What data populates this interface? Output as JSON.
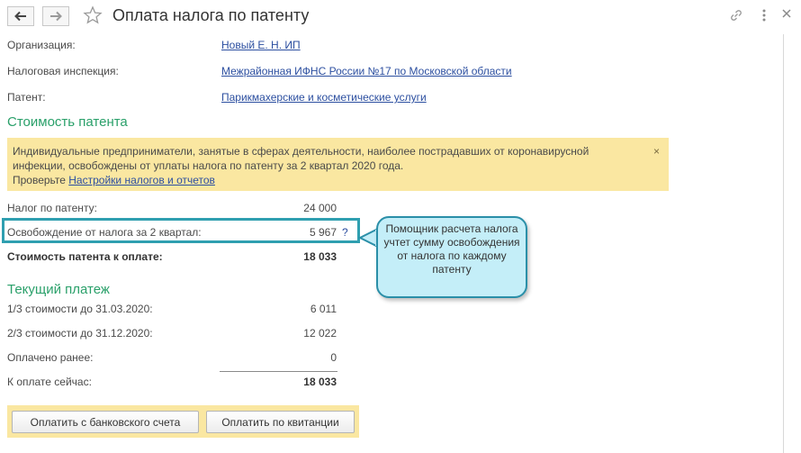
{
  "header": {
    "title": "Оплата налога по патенту",
    "back_icon": "arrow-left-icon",
    "forward_icon": "arrow-right-icon",
    "favorite_icon": "star-icon",
    "link_icon": "link-icon",
    "more_icon": "more-vertical-icon"
  },
  "fields": {
    "organization_label": "Организация:",
    "organization_value": "Новый Е. Н. ИП",
    "tax_office_label": "Налоговая инспекция:",
    "tax_office_value": "Межрайонная ИФНС России №17 по Московской области",
    "patent_label": "Патент:",
    "patent_value": "Парикмахерские и косметические услуги"
  },
  "patent_cost": {
    "section_title": "Стоимость патента",
    "notice_line1": "Индивидуальные предприниматели, занятые в сферах деятельности, наиболее пострадавших от коронавирусной",
    "notice_line2": "инфекции, освобождены от уплаты налога по патенту за 2 квартал 2020 года.",
    "notice_check": "Проверьте",
    "notice_link": "Настройки налогов и отчетов",
    "notice_close": "×",
    "tax_label": "Налог по патенту:",
    "tax_value": "24 000",
    "exemption_label": "Освобождение от налога за 2 квартал:",
    "exemption_value": "5 967",
    "help_mark": "?",
    "total_label": "Стоимость патента к оплате:",
    "total_value": "18 033"
  },
  "callout": {
    "text": "Помощник расчета налога учтет сумму освобождения от налога по каждому патенту"
  },
  "current_payment": {
    "section_title": "Текущий платеж",
    "row1_label": "1/3 стоимости до 31.03.2020:",
    "row1_value": "6 011",
    "row2_label": "2/3 стоимости до 31.12.2020:",
    "row2_value": "12 022",
    "paid_label": "Оплачено ранее:",
    "paid_value": "0",
    "due_label": "К оплате сейчас:",
    "due_value": "18 033"
  },
  "buttons": {
    "pay_bank": "Оплатить с банковского счета",
    "pay_receipt": "Оплатить по квитанции"
  },
  "colors": {
    "accent_green": "#2aa06a",
    "link_blue": "#2c4fa0",
    "notice_yellow": "#fae7a1",
    "highlight_teal": "#2f9fb0",
    "callout_fill": "#c4eef8"
  }
}
